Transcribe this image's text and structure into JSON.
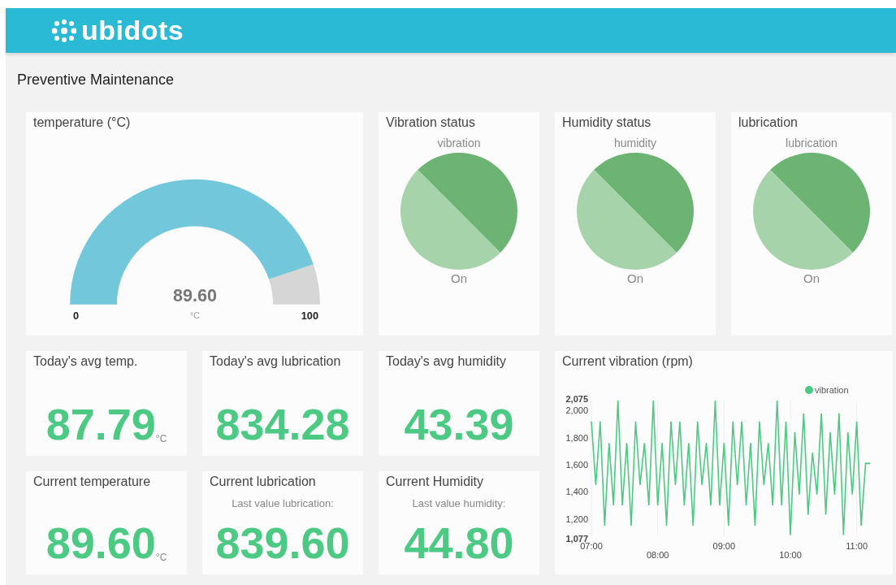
{
  "header": {
    "logo_text": "ubidots"
  },
  "page_title": "Preventive Maintenance",
  "top_cards": [
    {
      "kind": "gauge",
      "title": "temperature (°C)",
      "value": "89.60",
      "unit": "°C",
      "min": "0",
      "max": "100"
    },
    {
      "kind": "indicator",
      "title": "Vibration status",
      "variable": "vibration",
      "state": "On"
    },
    {
      "kind": "indicator",
      "title": "Humidity status",
      "variable": "humidity",
      "state": "On"
    },
    {
      "kind": "indicator",
      "title": "lubrication",
      "variable": "lubrication",
      "state": "On"
    }
  ],
  "metric_cards": [
    {
      "title": "Today's avg temp.",
      "value": "87.79",
      "unit": "°C"
    },
    {
      "title": "Today's avg lubrication",
      "value": "834.28"
    },
    {
      "title": "Today's avg humidity",
      "value": "43.39"
    },
    {
      "title": "Current temperature",
      "value": "89.60",
      "unit": "°C"
    },
    {
      "title": "Current lubrication",
      "subtitle": "Last value lubrication:",
      "value": "839.60"
    },
    {
      "title": "Current Humidity",
      "subtitle": "Last value humidity:",
      "value": "44.80"
    }
  ],
  "chart_card": {
    "title": "Current vibration (rpm)",
    "chart_data": {
      "type": "line",
      "grid": true,
      "ylim": [
        1077,
        2075
      ],
      "yticks": [
        {
          "value": 1077,
          "label": "1,077"
        },
        {
          "value": 1200,
          "label": "1,200"
        },
        {
          "value": 1400,
          "label": "1,400"
        },
        {
          "value": 1600,
          "label": "1,600"
        },
        {
          "value": 1800,
          "label": "1,800"
        },
        {
          "value": 2000,
          "label": "2,000"
        },
        {
          "value": 2075,
          "label": "2,075"
        }
      ],
      "categories": [
        "07:00",
        null,
        null,
        null,
        null,
        null,
        null,
        null,
        null,
        null,
        null,
        null,
        null,
        null,
        null,
        "08:00",
        null,
        null,
        null,
        null,
        null,
        null,
        null,
        null,
        null,
        null,
        null,
        null,
        null,
        null,
        "09:00",
        null,
        null,
        null,
        null,
        null,
        null,
        null,
        null,
        null,
        null,
        null,
        null,
        null,
        null,
        "10:00",
        null,
        null,
        null,
        null,
        null,
        null,
        null,
        null,
        null,
        null,
        null,
        null,
        null,
        null,
        "11:00",
        null,
        null,
        null
      ],
      "series": [
        {
          "name": "vibration",
          "color": "#4cc983",
          "values": [
            1920,
            1450,
            1920,
            1150,
            1760,
            1300,
            2075,
            1300,
            1760,
            1150,
            1920,
            1450,
            1760,
            1300,
            2075,
            1300,
            1760,
            1150,
            1920,
            1450,
            1920,
            1300,
            1760,
            1150,
            1920,
            1450,
            1760,
            1300,
            2075,
            1300,
            1760,
            1150,
            1920,
            1450,
            1920,
            1300,
            1760,
            1150,
            1920,
            1450,
            1760,
            1300,
            2075,
            1300,
            1920,
            1080,
            1840,
            1380,
            1980,
            1230,
            1690,
            1380,
            1980,
            1230,
            1840,
            1380,
            1980,
            1080,
            1840,
            1380,
            1920,
            1150,
            1610,
            1610
          ]
        }
      ]
    }
  }
}
